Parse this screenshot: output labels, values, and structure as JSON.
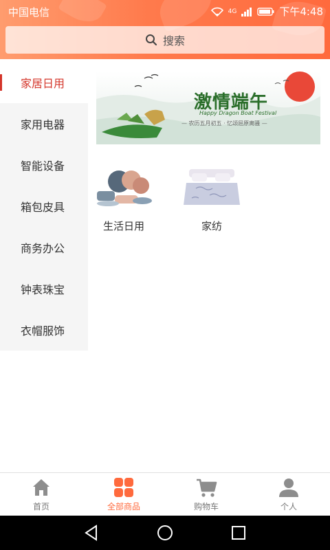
{
  "status_bar": {
    "carrier": "中国电信",
    "network": "4G",
    "time": "下午4:48"
  },
  "search": {
    "placeholder": "搜索"
  },
  "sidebar": {
    "items": [
      {
        "label": "家居日用",
        "active": true
      },
      {
        "label": "家用电器",
        "active": false
      },
      {
        "label": "智能设备",
        "active": false
      },
      {
        "label": "箱包皮具",
        "active": false
      },
      {
        "label": "商务办公",
        "active": false
      },
      {
        "label": "钟表珠宝",
        "active": false
      },
      {
        "label": "衣帽服饰",
        "active": false
      }
    ]
  },
  "banner": {
    "title": "激情端午",
    "subtitle": "Happy Dragon Boat Festival",
    "caption": "— 农历五月初五 · 忆颂屈原离骚 —"
  },
  "categories": [
    {
      "label": "生活日用",
      "image": "tableware-set"
    },
    {
      "label": "家纺",
      "image": "bedding-set"
    }
  ],
  "tabbar": {
    "items": [
      {
        "label": "首页",
        "icon": "home-icon",
        "active": false
      },
      {
        "label": "全部商品",
        "icon": "grid-icon",
        "active": true
      },
      {
        "label": "购物车",
        "icon": "cart-icon",
        "active": false
      },
      {
        "label": "个人",
        "icon": "person-icon",
        "active": false
      }
    ]
  },
  "colors": {
    "accent": "#ff6a3d",
    "active_sidebar": "#d4352a"
  }
}
